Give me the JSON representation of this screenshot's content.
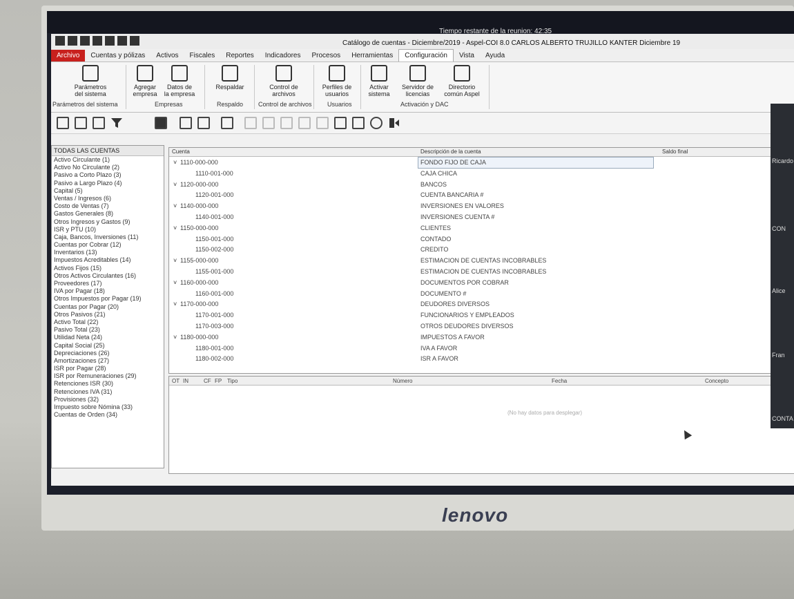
{
  "meeting": {
    "timer": "Tiempo restante de la reunion: 42:35"
  },
  "app": {
    "title": "Catálogo de cuentas - Diciembre/2019 - Aspel-COI 8.0 CARLOS ALBERTO TRUJILLO KANTER Diciembre 19"
  },
  "menu": [
    "Archivo",
    "Cuentas y pólizas",
    "Activos",
    "Fiscales",
    "Reportes",
    "Indicadores",
    "Procesos",
    "Herramientas",
    "Configuración",
    "Vista",
    "Ayuda"
  ],
  "ribbon": {
    "buttons": [
      {
        "l1": "Parámetros",
        "l2": "del sistema"
      },
      {
        "l1": "Agregar",
        "l2": "empresa"
      },
      {
        "l1": "Datos de",
        "l2": "la empresa"
      },
      {
        "l1": "Respaldar",
        "l2": ""
      },
      {
        "l1": "Control de",
        "l2": "archivos"
      },
      {
        "l1": "Perfiles de",
        "l2": "usuarios"
      },
      {
        "l1": "Activar",
        "l2": "sistema"
      },
      {
        "l1": "Servidor de",
        "l2": "licencias"
      },
      {
        "l1": "Directorio",
        "l2": "común Aspel"
      }
    ],
    "groups": [
      "Parámetros del sistema",
      "Empresas",
      "Respaldo",
      "Control de archivos",
      "Usuarios",
      "Activación y DAC"
    ]
  },
  "sidebar": {
    "header": "TODAS LAS CUENTAS",
    "items": [
      "Activo Circulante (1)",
      "Activo No Circulante (2)",
      "Pasivo a Corto Plazo (3)",
      "Pasivo a Largo Plazo (4)",
      "Capital (5)",
      "Ventas / Ingresos (6)",
      "Costo de Ventas (7)",
      "Gastos Generales (8)",
      "Otros Ingresos y Gastos (9)",
      "ISR y PTU (10)",
      "Caja, Bancos, Inversiones (11)",
      "Cuentas por Cobrar (12)",
      "Inventarios (13)",
      "Impuestos Acreditables (14)",
      "Activos Fijos (15)",
      "Otros Activos Circulantes (16)",
      "Proveedores (17)",
      "IVA por Pagar (18)",
      "Otros Impuestos por Pagar (19)",
      "Cuentas por Pagar (20)",
      "Otros Pasivos (21)",
      "Activo Total (22)",
      "Pasivo Total (23)",
      "Utilidad Neta (24)",
      "Capital Social (25)",
      "Depreciaciones (26)",
      "Amortizaciones (27)",
      "ISR por Pagar (28)",
      "ISR por Remuneraciones (29)",
      "Retenciones ISR (30)",
      "Retenciones IVA (31)",
      "Provisiones (32)",
      "Impuesto sobre Nómina (33)",
      "Cuentas de Orden (34)"
    ]
  },
  "grid": {
    "columns": [
      "Cuenta",
      "Descripción de la cuenta",
      "Saldo final"
    ],
    "rows": [
      {
        "acct": "1110-000-000",
        "desc": "FONDO FIJO DE CAJA",
        "parent": true
      },
      {
        "acct": "1110-001-000",
        "desc": "CAJA CHICA",
        "parent": false
      },
      {
        "acct": "1120-000-000",
        "desc": "BANCOS",
        "parent": true
      },
      {
        "acct": "1120-001-000",
        "desc": "CUENTA BANCARIA #",
        "parent": false
      },
      {
        "acct": "1140-000-000",
        "desc": "INVERSIONES EN VALORES",
        "parent": true
      },
      {
        "acct": "1140-001-000",
        "desc": "INVERSIONES CUENTA #",
        "parent": false
      },
      {
        "acct": "1150-000-000",
        "desc": "CLIENTES",
        "parent": true
      },
      {
        "acct": "1150-001-000",
        "desc": "CONTADO",
        "parent": false
      },
      {
        "acct": "1150-002-000",
        "desc": "CREDITO",
        "parent": false
      },
      {
        "acct": "1155-000-000",
        "desc": "ESTIMACION DE CUENTAS INCOBRABLES",
        "parent": true
      },
      {
        "acct": "1155-001-000",
        "desc": "ESTIMACION DE CUENTAS INCOBRABLES",
        "parent": false
      },
      {
        "acct": "1160-000-000",
        "desc": "DOCUMENTOS POR COBRAR",
        "parent": true
      },
      {
        "acct": "1160-001-000",
        "desc": "DOCUMENTO #",
        "parent": false
      },
      {
        "acct": "1170-000-000",
        "desc": "DEUDORES DIVERSOS",
        "parent": true
      },
      {
        "acct": "1170-001-000",
        "desc": "FUNCIONARIOS Y EMPLEADOS",
        "parent": false
      },
      {
        "acct": "1170-003-000",
        "desc": "OTROS DEUDORES DIVERSOS",
        "parent": false
      },
      {
        "acct": "1180-000-000",
        "desc": "IMPUESTOS A FAVOR",
        "parent": true
      },
      {
        "acct": "1180-001-000",
        "desc": "IVA A FAVOR",
        "parent": false
      },
      {
        "acct": "1180-002-000",
        "desc": "ISR A FAVOR",
        "parent": false
      }
    ]
  },
  "lower": {
    "columns": [
      "OT",
      "IN",
      "CF",
      "FP",
      "Tipo",
      "Número",
      "Fecha",
      "Concepto"
    ],
    "empty": "(No hay datos para desplegar)"
  },
  "participants": [
    "Ricardo",
    "CON",
    "Alice",
    "Fran",
    "CONTA"
  ],
  "brand": "lenovo"
}
